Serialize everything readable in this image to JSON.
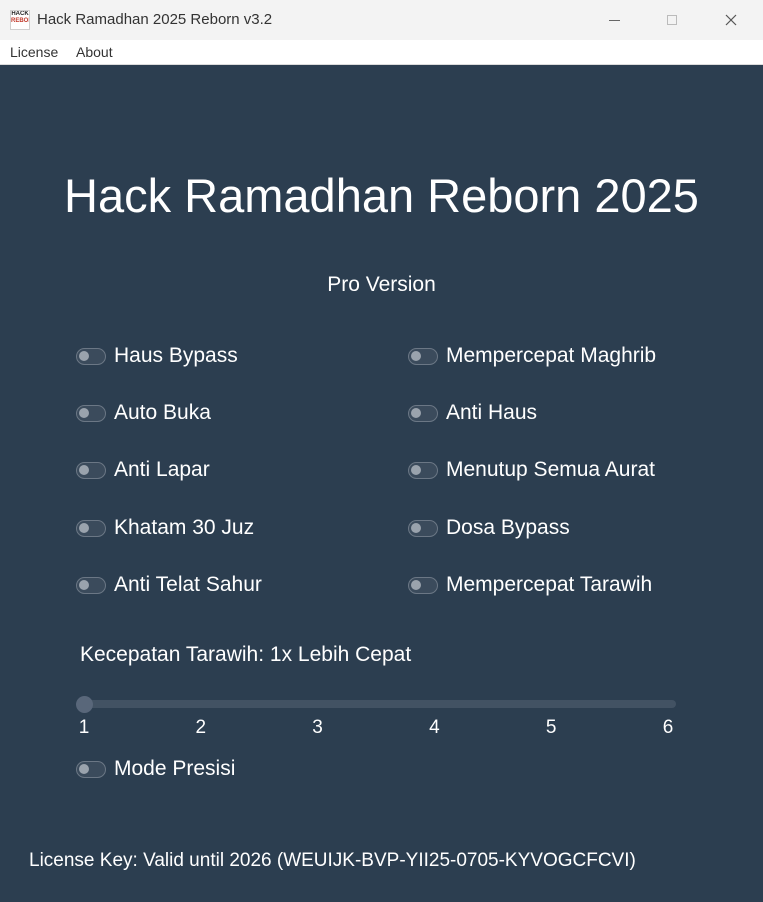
{
  "window": {
    "title": "Hack Ramadhan 2025 Reborn v3.2",
    "icon_top": "HACK",
    "icon_bottom": "REBORN",
    "controls": [
      "minimize",
      "maximize",
      "close"
    ]
  },
  "menu": {
    "items": [
      {
        "label": "License"
      },
      {
        "label": "About"
      }
    ]
  },
  "main": {
    "title": "Hack Ramadhan Reborn 2025",
    "subtitle": "Pro Version"
  },
  "toggles": {
    "left": [
      {
        "label": "Haus Bypass",
        "on": false
      },
      {
        "label": "Auto Buka",
        "on": false
      },
      {
        "label": "Anti Lapar",
        "on": false
      },
      {
        "label": "Khatam 30 Juz",
        "on": false
      },
      {
        "label": "Anti Telat Sahur",
        "on": false
      }
    ],
    "right": [
      {
        "label": "Mempercepat Maghrib",
        "on": false
      },
      {
        "label": "Anti Haus",
        "on": false
      },
      {
        "label": "Menutup Semua Aurat",
        "on": false
      },
      {
        "label": "Dosa Bypass",
        "on": false
      },
      {
        "label": "Mempercepat Tarawih",
        "on": false
      }
    ]
  },
  "speed": {
    "label": "Kecepatan Tarawih: 1x Lebih Cepat",
    "min": 1,
    "max": 6,
    "value": 1,
    "ticks": [
      "1",
      "2",
      "3",
      "4",
      "5",
      "6"
    ]
  },
  "precision_mode": {
    "label": "Mode Presisi",
    "on": false
  },
  "footer": {
    "license_text": "License Key: Valid until 2026 (WEUIJK-BVP-YII25-0705-KYVOGCFCVI)"
  },
  "colors": {
    "background": "#2c3e50",
    "text": "#ffffff",
    "track": "#425263",
    "handle": "#59677a"
  }
}
